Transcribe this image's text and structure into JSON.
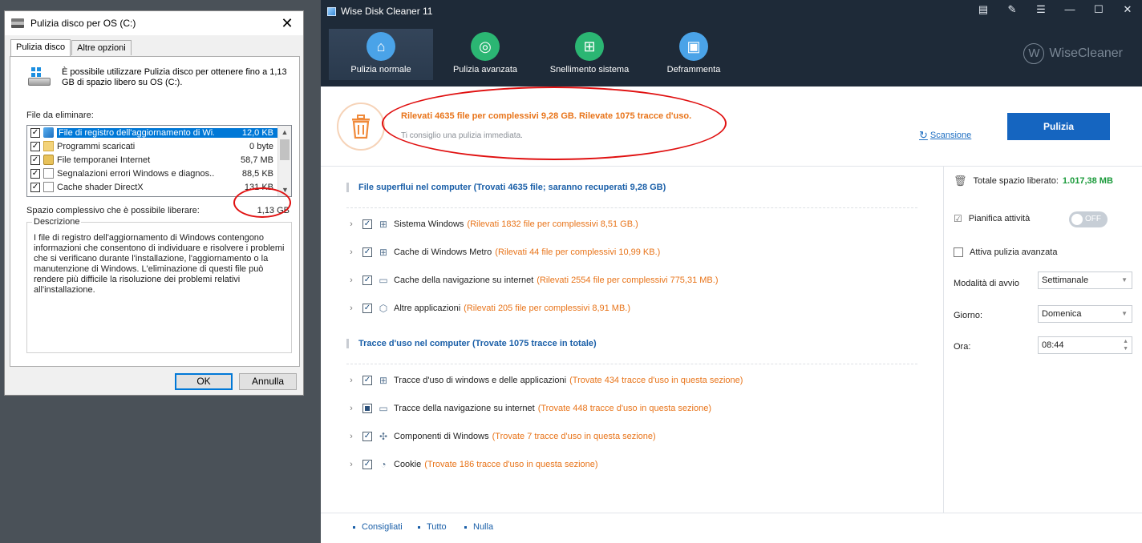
{
  "dialog": {
    "title": "Pulizia disco per OS (C:)",
    "close_glyph": "✕",
    "tabs": [
      "Pulizia disco",
      "Altre opzioni"
    ],
    "intro": "È possibile utilizzare Pulizia disco per ottenere fino a 1,13 GB di spazio libero su OS (C:).",
    "files_label": "File da eliminare:",
    "files": [
      {
        "name": "File di registro dell'aggiornamento di Wi...",
        "size": "12,0 KB",
        "checked": true,
        "icon": "windows-logo-icon"
      },
      {
        "name": "Programmi scaricati",
        "size": "0 byte",
        "checked": true,
        "icon": "folder-icon"
      },
      {
        "name": "File temporanei Internet",
        "size": "58,7 MB",
        "checked": true,
        "icon": "lock-icon"
      },
      {
        "name": "Segnalazioni errori Windows e diagnos...",
        "size": "88,5 KB",
        "checked": true,
        "icon": "document-icon"
      },
      {
        "name": "Cache shader DirectX",
        "size": "131 KB",
        "checked": true,
        "icon": "document-icon"
      }
    ],
    "total_label": "Spazio complessivo che è possibile liberare:",
    "total_value": "1,13 GB",
    "desc_legend": "Descrizione",
    "desc_text": "I file di registro dell'aggiornamento di Windows contengono informazioni che consentono di individuare e risolvere i problemi che si verificano durante l'installazione, l'aggiornamento o la manutenzione di Windows. L'eliminazione di questi file può rendere più difficile la risoluzione dei problemi relativi all'installazione.",
    "ok_label": "OK",
    "cancel_label": "Annulla"
  },
  "app": {
    "title": "Wise Disk Cleaner 11",
    "window_controls": [
      "▤",
      "✎",
      "☰",
      "—",
      "☐",
      "✕"
    ],
    "nav": [
      {
        "label": "Pulizia normale",
        "icon": "broom-icon",
        "color": "#4aa3e8",
        "glyph": "⌂",
        "active": true
      },
      {
        "label": "Pulizia avanzata",
        "icon": "advanced-clean-icon",
        "color": "#2bb673",
        "glyph": "◎",
        "active": false
      },
      {
        "label": "Snellimento sistema",
        "icon": "windows-slim-icon",
        "color": "#2bb673",
        "glyph": "⊞",
        "active": false
      },
      {
        "label": "Deframmenta",
        "icon": "defrag-icon",
        "color": "#4aa3e8",
        "glyph": "▣",
        "active": false
      }
    ],
    "brand": "WiseCleaner",
    "brand_mark": "W",
    "summary": {
      "headline": "Rilevati 4635 file per complessivi 9,28 GB. Rilevate 1075 tracce d'uso.",
      "sub": "Ti consiglio una pulizia immediata.",
      "scan_label": "Scansione",
      "scan_glyph": "↻",
      "clean_label": "Pulizia"
    },
    "section1": {
      "title": "File superflui nel computer  (Trovati 4635 file; saranno recuperati 9,28 GB)",
      "items": [
        {
          "name": "Sistema Windows",
          "detail": "(Rilevati 1832 file per complessivi 8,51 GB.)",
          "state": "checked",
          "icon": "windows-icon",
          "glyph": "⊞"
        },
        {
          "name": "Cache di Windows Metro",
          "detail": "(Rilevati 44 file per complessivi 10,99 KB.)",
          "state": "checked",
          "icon": "metro-icon",
          "glyph": "⊞"
        },
        {
          "name": "Cache della navigazione su internet",
          "detail": "(Rilevati 2554 file per complessivi 775,31 MB.)",
          "state": "checked",
          "icon": "browser-icon",
          "glyph": "▭"
        },
        {
          "name": "Altre applicazioni",
          "detail": "(Rilevati 205 file per complessivi 8,91 MB.)",
          "state": "checked",
          "icon": "box-icon",
          "glyph": "⬡"
        }
      ]
    },
    "section2": {
      "title": "Tracce d'uso nel computer  (Trovate 1075 tracce in totale)",
      "items": [
        {
          "name": "Tracce d'uso di windows e delle applicazioni",
          "detail": "(Trovate 434 tracce d'uso in questa sezione)",
          "state": "checked",
          "icon": "windows-icon",
          "glyph": "⊞"
        },
        {
          "name": "Tracce della navigazione su internet",
          "detail": "(Trovate 448 tracce d'uso in questa sezione)",
          "state": "partial",
          "icon": "browser-icon",
          "glyph": "▭"
        },
        {
          "name": "Componenti di Windows",
          "detail": "(Trovate 7 tracce d'uso in questa sezione)",
          "state": "checked",
          "icon": "puzzle-icon",
          "glyph": "✣"
        },
        {
          "name": "Cookie",
          "detail": "(Trovate 186 tracce d'uso in questa sezione)",
          "state": "checked",
          "icon": "cookie-icon",
          "glyph": "◔"
        }
      ]
    },
    "side": {
      "freed_label": "Totale spazio liberato:",
      "freed_value": "1.017,38 MB",
      "schedule_label": "Pianifica attività",
      "toggle_label": "OFF",
      "advanced_label": "Attiva pulizia avanzata",
      "mode_label": "Modalità di avvio",
      "mode_value": "Settimanale",
      "day_label": "Giorno:",
      "day_value": "Domenica",
      "time_label": "Ora:",
      "time_value": "08:44"
    },
    "footer": [
      "Consigliati",
      "Tutto",
      "Nulla"
    ]
  }
}
